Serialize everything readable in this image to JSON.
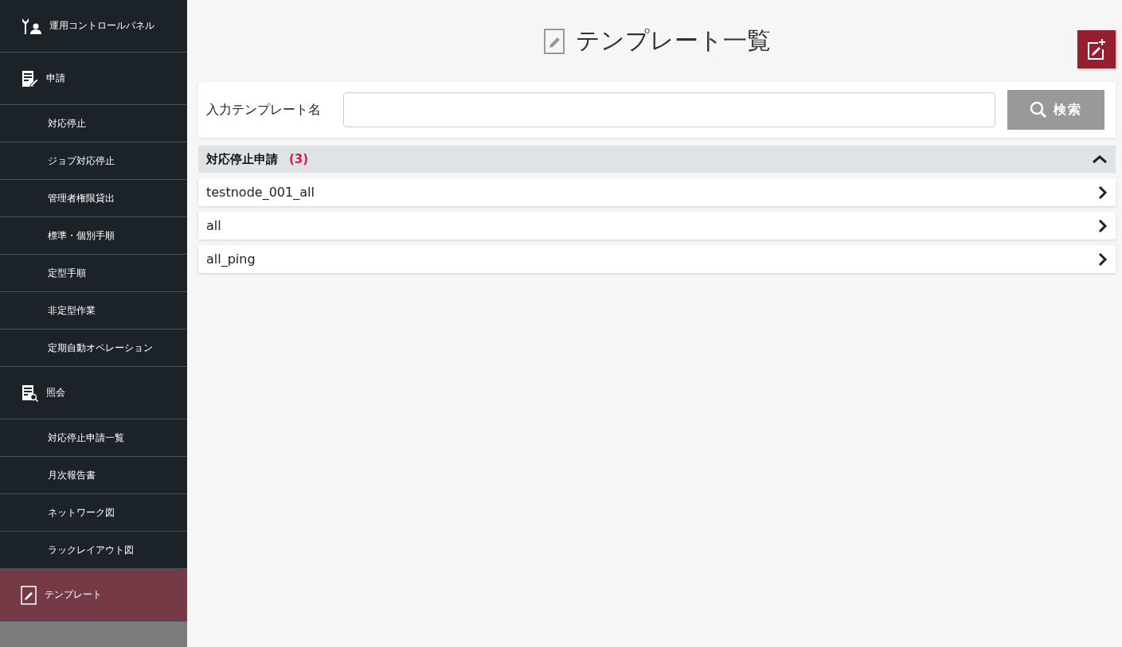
{
  "sidebar": {
    "items": [
      {
        "kind": "section",
        "label": "運用コントロールパネル",
        "selected": false
      },
      {
        "kind": "section",
        "label": "申請",
        "selected": false
      },
      {
        "kind": "item",
        "label": "対応停止",
        "selected": false
      },
      {
        "kind": "item",
        "label": "ジョブ対応停止",
        "selected": false
      },
      {
        "kind": "item",
        "label": "管理者権限貸出",
        "selected": false
      },
      {
        "kind": "item",
        "label": "標準・個別手順",
        "selected": false
      },
      {
        "kind": "item",
        "label": "定型手順",
        "selected": false
      },
      {
        "kind": "item",
        "label": "非定型作業",
        "selected": false
      },
      {
        "kind": "item",
        "label": "定期自動オペレーション",
        "selected": false
      },
      {
        "kind": "section",
        "label": "照会",
        "selected": false
      },
      {
        "kind": "item",
        "label": "対応停止申請一覧",
        "selected": false
      },
      {
        "kind": "item",
        "label": "月次報告書",
        "selected": false
      },
      {
        "kind": "item",
        "label": "ネットワーク図",
        "selected": false
      },
      {
        "kind": "item",
        "label": "ラックレイアウト図",
        "selected": false
      },
      {
        "kind": "section",
        "label": "テンプレート",
        "selected": true
      }
    ]
  },
  "page": {
    "title": "テンプレート一覧"
  },
  "search": {
    "label": "入力テンプレート名",
    "button": "検索"
  },
  "groups": [
    {
      "title": "対応停止申請",
      "count": "(3)",
      "expanded": true,
      "rows": [
        "testnode_001_all",
        "all",
        "all_ping"
      ]
    }
  ]
}
